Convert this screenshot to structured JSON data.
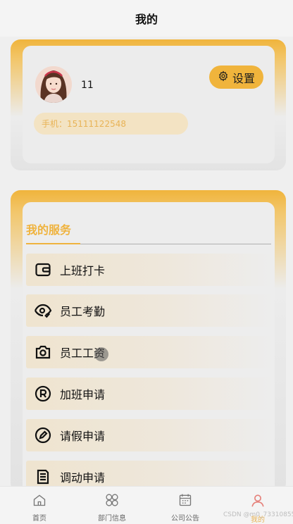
{
  "header": {
    "title": "我的"
  },
  "profile": {
    "username": "11",
    "phone": "手机：15111122548",
    "settings_label": "设置"
  },
  "services": {
    "title": "我的服务",
    "items": [
      {
        "label": "上班打卡",
        "icon": "wallet-icon"
      },
      {
        "label": "员工考勤",
        "icon": "eye-check-icon"
      },
      {
        "label": "员工工资",
        "icon": "camera-icon"
      },
      {
        "label": "加班申请",
        "icon": "registered-icon"
      },
      {
        "label": "请假申请",
        "icon": "edit-circle-icon"
      },
      {
        "label": "调动申请",
        "icon": "document-icon"
      }
    ]
  },
  "tabbar": {
    "items": [
      {
        "label": "首页",
        "icon": "home-icon",
        "active": false
      },
      {
        "label": "部门信息",
        "icon": "clover-icon",
        "active": false
      },
      {
        "label": "公司公告",
        "icon": "calendar-icon",
        "active": false
      },
      {
        "label": "我的",
        "icon": "person-icon",
        "active": true
      }
    ]
  },
  "watermark": "CSDN @m0_73310855",
  "colors": {
    "accent": "#f0b43c",
    "accent_text": "#efb33e",
    "active_tab": "#e5807a"
  }
}
